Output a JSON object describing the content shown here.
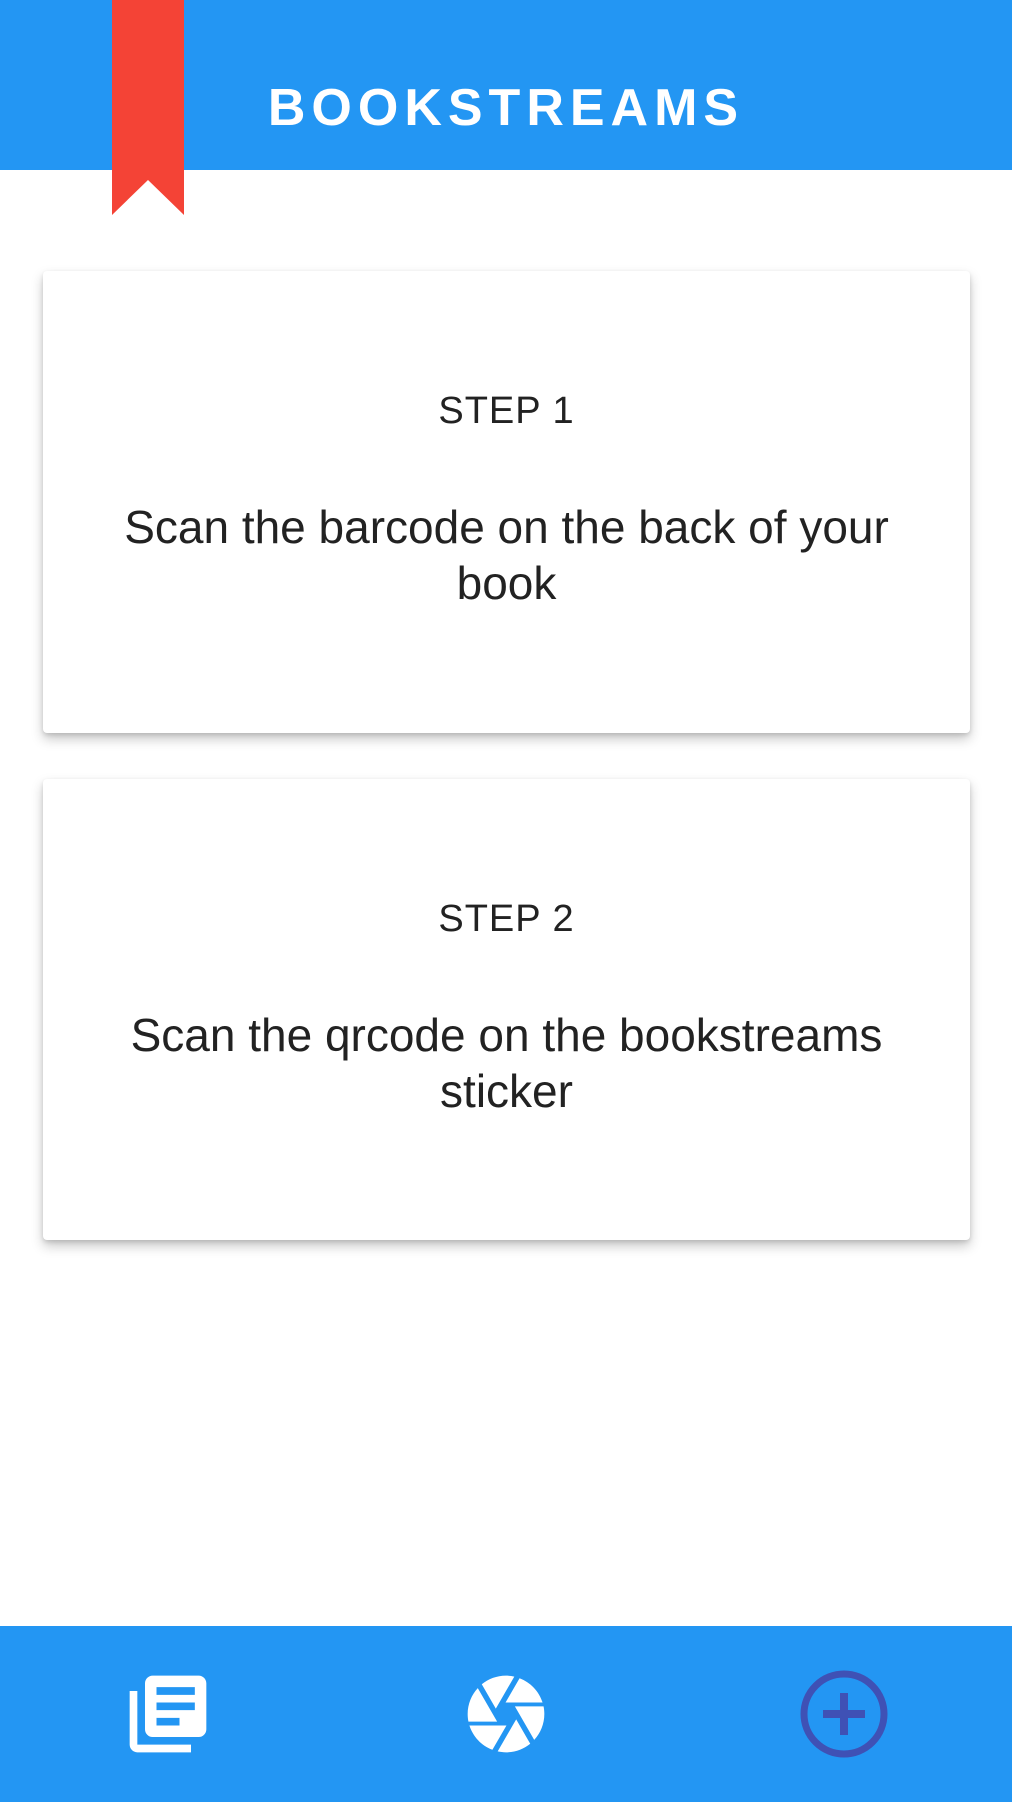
{
  "app": {
    "title": "BOOKSTREAMS"
  },
  "colors": {
    "primary": "#2396f3",
    "bookmark": "#f44336",
    "add_icon": "#3f51b5",
    "text": "#222222",
    "background": "#ffffff"
  },
  "steps": [
    {
      "label": "STEP 1",
      "text": "Scan the barcode on the back of your book"
    },
    {
      "label": "STEP 2",
      "text": "Scan the qrcode on the bookstreams sticker"
    }
  ],
  "bottom_nav": {
    "items": [
      {
        "icon": "library-books-icon"
      },
      {
        "icon": "camera-shutter-icon"
      },
      {
        "icon": "add-circle-icon"
      }
    ]
  }
}
